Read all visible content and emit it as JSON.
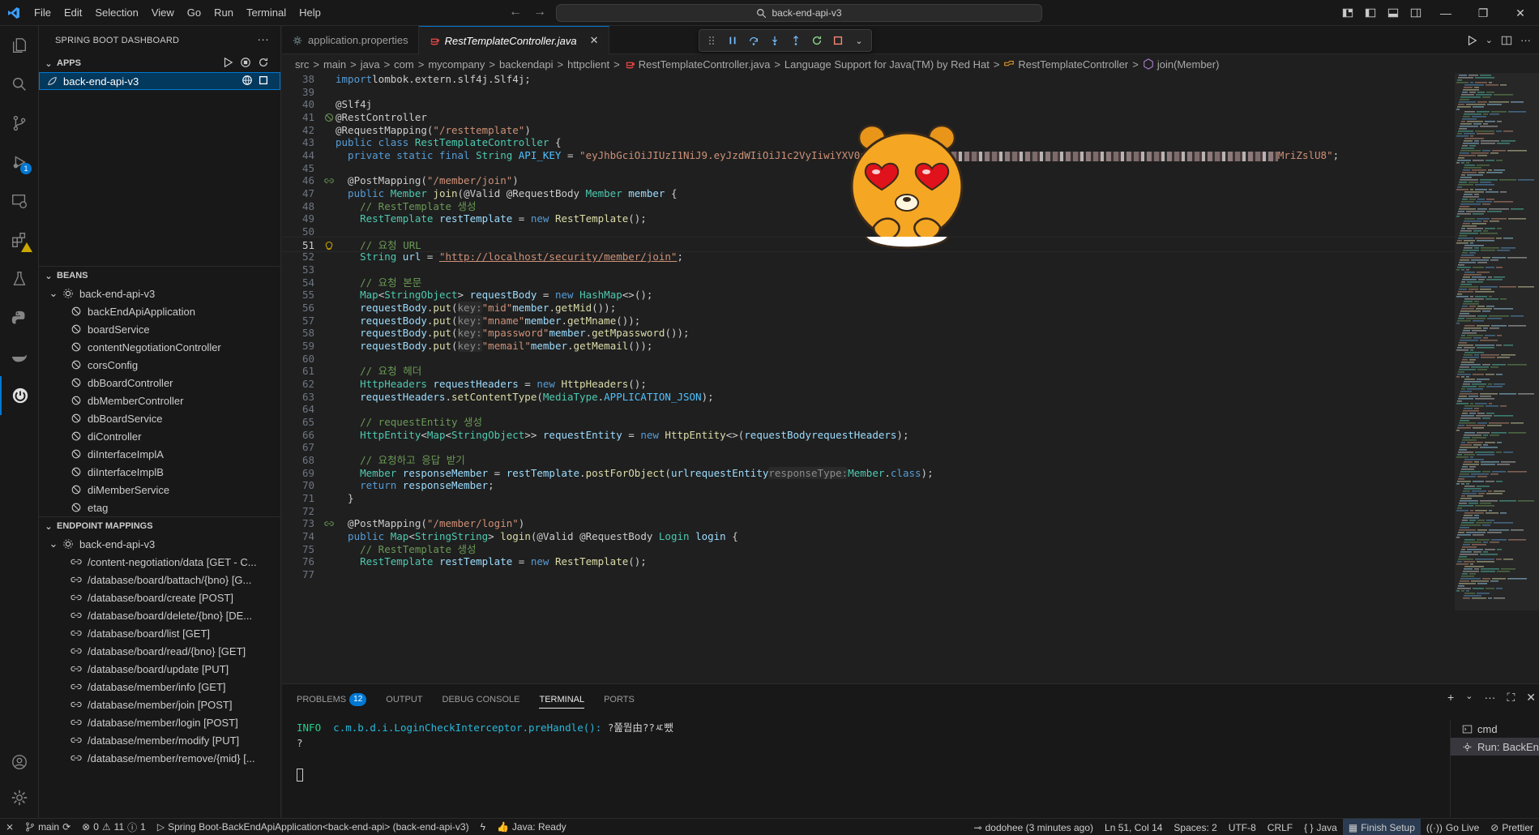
{
  "menu": [
    "File",
    "Edit",
    "Selection",
    "View",
    "Go",
    "Run",
    "Terminal",
    "Help"
  ],
  "search": {
    "text": "back-end-api-v3"
  },
  "sidebar": {
    "title": "SPRING BOOT DASHBOARD",
    "apps_header": "APPS",
    "app_item": "back-end-api-v3",
    "beans_header": "BEANS",
    "beans_root": "back-end-api-v3",
    "beans": [
      "backEndApiApplication",
      "boardService",
      "contentNegotiationController",
      "corsConfig",
      "dbBoardController",
      "dbMemberController",
      "dbBoardService",
      "diController",
      "diInterfaceImplA",
      "diInterfaceImplB",
      "diMemberService",
      "etag"
    ],
    "endpoints_header": "ENDPOINT MAPPINGS",
    "endpoints_root": "back-end-api-v3",
    "endpoints": [
      "/content-negotiation/data [GET - C...",
      "/database/board/battach/{bno} [G...",
      "/database/board/create [POST]",
      "/database/board/delete/{bno} [DE...",
      "/database/board/list [GET]",
      "/database/board/read/{bno} [GET]",
      "/database/board/update [PUT]",
      "/database/member/info [GET]",
      "/database/member/join [POST]",
      "/database/member/login [POST]",
      "/database/member/modify [PUT]",
      "/database/member/remove/{mid} [..."
    ]
  },
  "tabs": [
    {
      "label": "application.properties"
    },
    {
      "label": "RestTemplateController.java"
    }
  ],
  "breadcrumbs": [
    "src",
    "main",
    "java",
    "com",
    "mycompany",
    "backendapi",
    "httpclient",
    "RestTemplateController.java",
    "Language Support for Java(TM) by Red Hat",
    "RestTemplateController",
    "join(Member)"
  ],
  "code_lines": [
    {
      "n": "38",
      "segs": [
        [
          "kw",
          "import"
        ],
        [
          "",
          "lombok.extern.slf4j.Slf4j;"
        ]
      ]
    },
    {
      "n": "39",
      "segs": []
    },
    {
      "n": "40",
      "segs": [
        [
          "an",
          "@Slf4j"
        ]
      ]
    },
    {
      "n": "41",
      "segs": [
        [
          "an",
          "@RestController"
        ]
      ],
      "glyph": "bean"
    },
    {
      "n": "42",
      "segs": [
        [
          "an",
          "@RequestMapping("
        ],
        [
          "st",
          "\"/resttemplate\""
        ],
        [
          "an",
          ")"
        ]
      ]
    },
    {
      "n": "43",
      "segs": [
        [
          "kw",
          "public class "
        ],
        [
          "ty",
          "RestTemplateController"
        ],
        [
          "",
          " {"
        ]
      ]
    },
    {
      "n": "44",
      "segs": [
        [
          "kw",
          "  private static final "
        ],
        [
          "ty",
          "String "
        ],
        [
          "ct",
          "API_KEY"
        ],
        [
          "",
          " = "
        ],
        [
          "st",
          "\"eyJhbGciOiJIUzI1NiJ9.eyJzdWIiOiJ1c2VyIiwiYXV0aG9ya"
        ],
        [
          "blur",
          ""
        ],
        [
          "st",
          "MriZslU8\""
        ],
        [
          "",
          ";"
        ]
      ]
    },
    {
      "n": "45",
      "segs": []
    },
    {
      "n": "46",
      "segs": [
        [
          "an",
          "  @PostMapping("
        ],
        [
          "st",
          "\"/member/join\""
        ],
        [
          "an",
          ")"
        ]
      ],
      "glyph": "map"
    },
    {
      "n": "47",
      "segs": [
        [
          "kw",
          "  public "
        ],
        [
          "ty",
          "Member "
        ],
        [
          "fn",
          "join"
        ],
        [
          "",
          "("
        ],
        [
          "an",
          "@Valid @RequestBody "
        ],
        [
          "ty",
          "Member "
        ],
        [
          "va",
          "member"
        ],
        [
          "",
          " {"
        ]
      ]
    },
    {
      "n": "48",
      "segs": [
        [
          "cm",
          "    // RestTemplate 생성"
        ]
      ]
    },
    {
      "n": "49",
      "segs": [
        [
          "ty",
          "    RestTemplate "
        ],
        [
          "va",
          "restTemplate"
        ],
        [
          "",
          " = "
        ],
        [
          "kw",
          "new "
        ],
        [
          "fn",
          "RestTemplate"
        ],
        [
          "",
          "();"
        ]
      ]
    },
    {
      "n": "50",
      "segs": []
    },
    {
      "n": "51",
      "segs": [
        [
          "cm",
          "    // 요청 URL"
        ]
      ],
      "glyph": "bulb",
      "current": true
    },
    {
      "n": "52",
      "segs": [
        [
          "ty",
          "    String "
        ],
        [
          "va",
          "url"
        ],
        [
          "",
          " = "
        ],
        [
          "url",
          "\"http://localhost/security/member/join\""
        ],
        [
          "",
          ";"
        ]
      ]
    },
    {
      "n": "53",
      "segs": []
    },
    {
      "n": "54",
      "segs": [
        [
          "cm",
          "    // 요청 본문"
        ]
      ]
    },
    {
      "n": "55",
      "segs": [
        [
          "ty",
          "    Map"
        ],
        [
          "",
          "<"
        ],
        [
          "ty",
          "String"
        ],
        [
          ", "
        ],
        [
          "ty",
          "Object"
        ],
        [
          "",
          "> "
        ],
        [
          "va",
          "requestBody"
        ],
        [
          "",
          " = "
        ],
        [
          "kw",
          "new "
        ],
        [
          "ty",
          "HashMap"
        ],
        [
          "",
          "<>();"
        ]
      ]
    },
    {
      "n": "56",
      "segs": [
        [
          "va",
          "    requestBody"
        ],
        [
          "",
          "."
        ],
        [
          "fn",
          "put"
        ],
        [
          "",
          "("
        ],
        [
          "hint",
          "key:"
        ],
        [
          " "
        ],
        [
          "st",
          "\"mid\""
        ],
        [
          ", "
        ],
        [
          "va",
          "member"
        ],
        [
          "",
          "."
        ],
        [
          "fn",
          "getMid"
        ],
        [
          "",
          "());"
        ]
      ]
    },
    {
      "n": "57",
      "segs": [
        [
          "va",
          "    requestBody"
        ],
        [
          "",
          "."
        ],
        [
          "fn",
          "put"
        ],
        [
          "",
          "("
        ],
        [
          "hint",
          "key:"
        ],
        [
          " "
        ],
        [
          "st",
          "\"mname\""
        ],
        [
          ", "
        ],
        [
          "va",
          "member"
        ],
        [
          "",
          "."
        ],
        [
          "fn",
          "getMname"
        ],
        [
          "",
          "());"
        ]
      ]
    },
    {
      "n": "58",
      "segs": [
        [
          "va",
          "    requestBody"
        ],
        [
          "",
          "."
        ],
        [
          "fn",
          "put"
        ],
        [
          "",
          "("
        ],
        [
          "hint",
          "key:"
        ],
        [
          " "
        ],
        [
          "st",
          "\"mpassword\""
        ],
        [
          ", "
        ],
        [
          "va",
          "member"
        ],
        [
          "",
          "."
        ],
        [
          "fn",
          "getMpassword"
        ],
        [
          "",
          "());"
        ]
      ]
    },
    {
      "n": "59",
      "segs": [
        [
          "va",
          "    requestBody"
        ],
        [
          "",
          "."
        ],
        [
          "fn",
          "put"
        ],
        [
          "",
          "("
        ],
        [
          "hint",
          "key:"
        ],
        [
          " "
        ],
        [
          "st",
          "\"memail\""
        ],
        [
          ", "
        ],
        [
          "va",
          "member"
        ],
        [
          "",
          "."
        ],
        [
          "fn",
          "getMemail"
        ],
        [
          "",
          "());"
        ]
      ]
    },
    {
      "n": "60",
      "segs": []
    },
    {
      "n": "61",
      "segs": [
        [
          "cm",
          "    // 요청 헤더"
        ]
      ]
    },
    {
      "n": "62",
      "segs": [
        [
          "ty",
          "    HttpHeaders "
        ],
        [
          "va",
          "requestHeaders"
        ],
        [
          "",
          " = "
        ],
        [
          "kw",
          "new "
        ],
        [
          "fn",
          "HttpHeaders"
        ],
        [
          "",
          "();"
        ]
      ]
    },
    {
      "n": "63",
      "segs": [
        [
          "va",
          "    requestHeaders"
        ],
        [
          "",
          "."
        ],
        [
          "fn",
          "setContentType"
        ],
        [
          "",
          "("
        ],
        [
          "ty",
          "MediaType"
        ],
        [
          "",
          "."
        ],
        [
          "ct",
          "APPLICATION_JSON"
        ],
        [
          "",
          ");"
        ]
      ]
    },
    {
      "n": "64",
      "segs": []
    },
    {
      "n": "65",
      "segs": [
        [
          "cm",
          "    // requestEntity 생성"
        ]
      ]
    },
    {
      "n": "66",
      "segs": [
        [
          "ty",
          "    HttpEntity"
        ],
        [
          "",
          "<"
        ],
        [
          "ty",
          "Map"
        ],
        [
          "",
          "<"
        ],
        [
          "ty",
          "String"
        ],
        [
          ", "
        ],
        [
          "ty",
          "Object"
        ],
        [
          "",
          ">> "
        ],
        [
          "va",
          "requestEntity"
        ],
        [
          "",
          " = "
        ],
        [
          "kw",
          "new "
        ],
        [
          "fn",
          "HttpEntity"
        ],
        [
          "",
          "<>("
        ],
        [
          "va",
          "requestBody"
        ],
        [
          ", "
        ],
        [
          "va",
          "requestHeaders"
        ],
        [
          "",
          ");"
        ]
      ]
    },
    {
      "n": "67",
      "segs": []
    },
    {
      "n": "68",
      "segs": [
        [
          "cm",
          "    // 요청하고 응답 받기"
        ]
      ]
    },
    {
      "n": "69",
      "segs": [
        [
          "ty",
          "    Member "
        ],
        [
          "va",
          "responseMember"
        ],
        [
          "",
          " = "
        ],
        [
          "va",
          "restTemplate"
        ],
        [
          "",
          "."
        ],
        [
          "fn",
          "postForObject"
        ],
        [
          "",
          "("
        ],
        [
          "va",
          "url"
        ],
        [
          ", "
        ],
        [
          "va",
          "requestEntity"
        ],
        [
          ", "
        ],
        [
          "hint",
          "responseType:"
        ],
        [
          " "
        ],
        [
          "ty",
          "Member"
        ],
        [
          "",
          "."
        ],
        [
          "kw",
          "class"
        ],
        [
          "",
          ");"
        ]
      ]
    },
    {
      "n": "70",
      "segs": [
        [
          "kw",
          "    return "
        ],
        [
          "va",
          "responseMember"
        ],
        [
          "",
          ";"
        ]
      ]
    },
    {
      "n": "71",
      "segs": [
        [
          "",
          "  }"
        ]
      ]
    },
    {
      "n": "72",
      "segs": []
    },
    {
      "n": "73",
      "segs": [
        [
          "an",
          "  @PostMapping("
        ],
        [
          "st",
          "\"/member/login\""
        ],
        [
          "an",
          ")"
        ]
      ],
      "glyph": "map"
    },
    {
      "n": "74",
      "segs": [
        [
          "kw",
          "  public "
        ],
        [
          "ty",
          "Map"
        ],
        [
          "",
          "<"
        ],
        [
          "ty",
          "String"
        ],
        [
          ", "
        ],
        [
          "ty",
          "String"
        ],
        [
          "",
          "> "
        ],
        [
          "fn",
          "login"
        ],
        [
          "",
          "("
        ],
        [
          "an",
          "@Valid @RequestBody "
        ],
        [
          "ty",
          "Login "
        ],
        [
          "va",
          "login"
        ],
        [
          "",
          " {"
        ]
      ]
    },
    {
      "n": "75",
      "segs": [
        [
          "cm",
          "    // RestTemplate 생성"
        ]
      ]
    },
    {
      "n": "76",
      "segs": [
        [
          "ty",
          "    RestTemplate "
        ],
        [
          "va",
          "restTemplate"
        ],
        [
          "",
          " = "
        ],
        [
          "kw",
          "new "
        ],
        [
          "fn",
          "RestTemplate"
        ],
        [
          "",
          "();"
        ]
      ]
    },
    {
      "n": "77",
      "segs": []
    }
  ],
  "panel": {
    "tabs": [
      "PROBLEMS",
      "OUTPUT",
      "DEBUG CONSOLE",
      "TERMINAL",
      "PORTS"
    ],
    "problems_count": "12",
    "terminal_line1_level": "INFO",
    "terminal_line1_class": "c.m.b.d.i.LoginCheckInterceptor.preHandle():",
    "terminal_line1_msg": "?쭖뭡由??ㅼ뺐",
    "terminal_line2": "?",
    "terminals": [
      "cmd",
      "Run: BackEn"
    ]
  },
  "status": {
    "branch": "main",
    "errors": "0",
    "warnings": "11",
    "infos": "1",
    "run_label": "Spring Boot-BackEndApiApplication<back-end-api> (back-end-api-v3)",
    "java_status": "Java: Ready",
    "blame": "dodohee (3 minutes ago)",
    "cursor": "Ln 51, Col 14",
    "spaces": "Spaces: 2",
    "encoding": "UTF-8",
    "eol": "CRLF",
    "language": "Java",
    "finish_setup": "Finish Setup",
    "go_live": "Go Live",
    "prettier": "Prettier"
  },
  "colors": {
    "accent": "#0078d4",
    "string": "#ce9178",
    "comment": "#6a9955",
    "type": "#4ec9b0",
    "keyword": "#569cd6",
    "function": "#dcdcaa",
    "variable": "#9cdcfe",
    "sticker_body": "#f5a623"
  },
  "icons": [
    "vscode-logo-icon",
    "explorer-icon",
    "search-icon",
    "source-control-icon",
    "run-debug-icon",
    "remote-explorer-icon",
    "extensions-icon",
    "testing-icon",
    "python-icon",
    "docker-icon",
    "spring-boot-icon",
    "accounts-icon",
    "manage-gear-icon"
  ]
}
